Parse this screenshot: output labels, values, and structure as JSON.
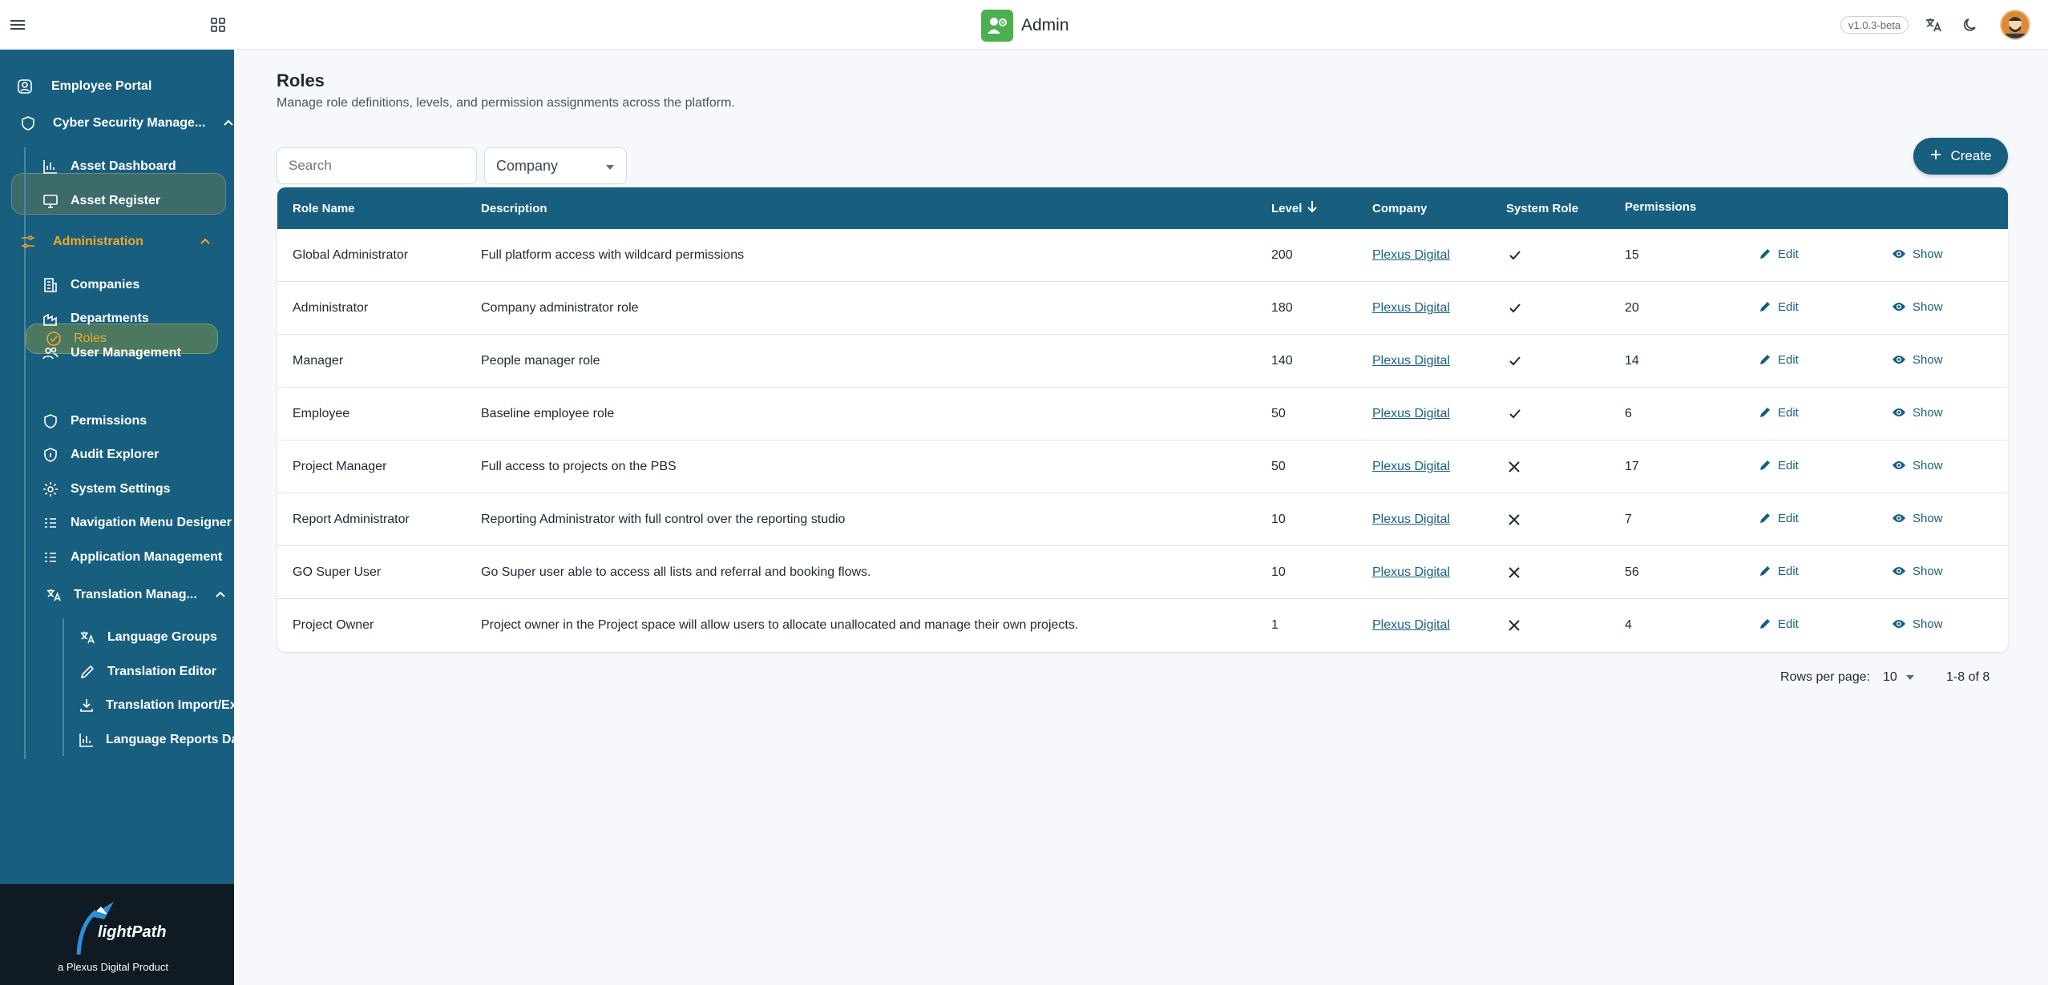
{
  "header": {
    "title": "Admin",
    "version": "v1.0.3-beta",
    "icons": [
      "menu-icon",
      "apps-grid-icon",
      "translate-icon",
      "dark-mode-icon",
      "user-avatar"
    ]
  },
  "sidebar": {
    "items": [
      {
        "label": "Employee Portal",
        "icon": "user-square-icon"
      },
      {
        "label": "Cyber Security Manage...",
        "icon": "shield-icon"
      },
      {
        "label": "Asset Dashboard",
        "icon": "bar-chart-icon"
      },
      {
        "label": "Asset Register",
        "icon": "monitor-icon"
      },
      {
        "label": "Administration",
        "icon": "sliders-icon"
      },
      {
        "label": "Companies",
        "icon": "building-icon"
      },
      {
        "label": "Departments",
        "icon": "department-icon"
      },
      {
        "label": "User Management",
        "icon": "users-icon"
      },
      {
        "label": "Roles",
        "icon": "shield-check-icon"
      },
      {
        "label": "Permissions",
        "icon": "shield-icon"
      },
      {
        "label": "Audit Explorer",
        "icon": "shield-info-icon"
      },
      {
        "label": "System Settings",
        "icon": "gear-icon"
      },
      {
        "label": "Navigation Menu Designer",
        "icon": "list-icon"
      },
      {
        "label": "Application Management",
        "icon": "list-icon"
      },
      {
        "label": "Translation Manag...",
        "icon": "translate-icon"
      },
      {
        "label": "Language Groups",
        "icon": "translate-icon"
      },
      {
        "label": "Translation Editor",
        "icon": "pencil-icon"
      },
      {
        "label": "Translation Import/Exp",
        "icon": "download-icon"
      },
      {
        "label": "Language Reports Das",
        "icon": "bar-chart-icon"
      }
    ],
    "footer": {
      "logo_text": "lightPath",
      "tagline": "a Plexus Digital Product"
    }
  },
  "page": {
    "title": "Roles",
    "subtitle": "Manage role definitions, levels, and permission assignments across the platform."
  },
  "filters": {
    "search_placeholder": "Search",
    "company_label": "Company",
    "create_label": "Create"
  },
  "table": {
    "columns": [
      "Role Name",
      "Description",
      "Level",
      "Company",
      "System Role",
      "Permissions"
    ],
    "edit_label": "Edit",
    "show_label": "Show",
    "rows": [
      {
        "name": "Global Administrator",
        "description": "Full platform access with wildcard permissions",
        "level": "200",
        "company": "Plexus Digital",
        "system": "yes",
        "permissions": "15"
      },
      {
        "name": "Administrator",
        "description": "Company administrator role",
        "level": "180",
        "company": "Plexus Digital",
        "system": "yes",
        "permissions": "20"
      },
      {
        "name": "Manager",
        "description": "People manager role",
        "level": "140",
        "company": "Plexus Digital",
        "system": "yes",
        "permissions": "14"
      },
      {
        "name": "Employee",
        "description": "Baseline employee role",
        "level": "50",
        "company": "Plexus Digital",
        "system": "yes",
        "permissions": "6"
      },
      {
        "name": "Project Manager",
        "description": "Full access to projects on the PBS",
        "level": "50",
        "company": "Plexus Digital",
        "system": "no",
        "permissions": "17"
      },
      {
        "name": "Report Administrator",
        "description": "Reporting Administrator with full control over the reporting studio",
        "level": "10",
        "company": "Plexus Digital",
        "system": "no",
        "permissions": "7"
      },
      {
        "name": "GO Super User",
        "description": "Go Super user able to access all lists and referral and booking flows.",
        "level": "10",
        "company": "Plexus Digital",
        "system": "no",
        "permissions": "56"
      },
      {
        "name": "Project Owner",
        "description": "Project owner in the Project space will allow users to allocate unallocated and manage their own projects.",
        "level": "1",
        "company": "Plexus Digital",
        "system": "no",
        "permissions": "4"
      }
    ]
  },
  "pagination": {
    "rows_per_page_label": "Rows per page:",
    "rows_per_page_value": "10",
    "range": "1-8 of 8"
  },
  "colors": {
    "primary": "#185f7f",
    "active": "#f5a623",
    "brand": "#4caf50"
  }
}
